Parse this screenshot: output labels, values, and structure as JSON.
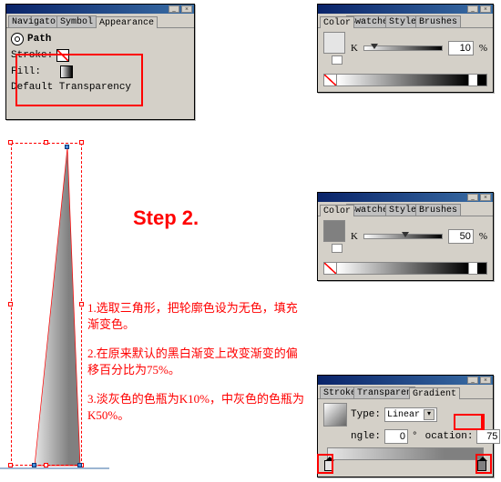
{
  "appearance_panel": {
    "tabs": [
      "Navigator",
      "Symbol",
      "Appearance"
    ],
    "path_label": "Path",
    "stroke_label": "Stroke:",
    "fill_label": "Fill:",
    "default_label": "Default Transparency"
  },
  "color_panel_1": {
    "tabs": [
      "Color",
      "Swatches",
      "Styles",
      "Brushes"
    ],
    "channel": "K",
    "value": "10",
    "unit": "%"
  },
  "color_panel_2": {
    "tabs": [
      "Color",
      "Swatches",
      "Styles",
      "Brushes"
    ],
    "channel": "K",
    "value": "50",
    "unit": "%"
  },
  "gradient_panel": {
    "tabs": [
      "Stroke",
      "Transparen",
      "Gradient"
    ],
    "type_label": "Type:",
    "type_value": "Linear",
    "angle_label": "ngle:",
    "angle_value": "0",
    "angle_unit": "°",
    "location_label": "ocation:",
    "location_value": "75",
    "location_unit": "%"
  },
  "step": {
    "title": "Step 2.",
    "line1": "1.选取三角形，把轮廓色设为无色，填充渐变色。",
    "line2": "2.在原来默认的黑白渐变上改变渐变的偏移百分比为75%。",
    "line3": "3.淡灰色的色瓶为K10%，中灰色的色瓶为K50%。"
  }
}
